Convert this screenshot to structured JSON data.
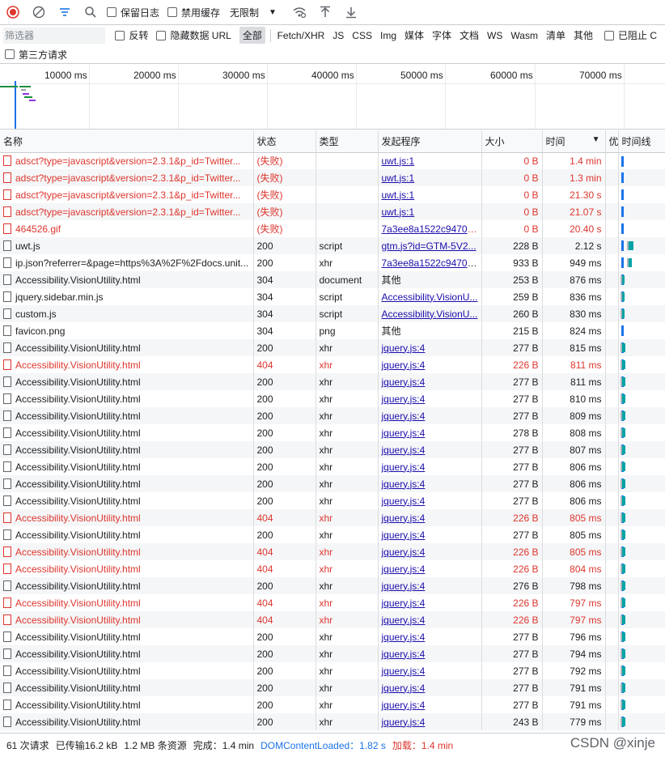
{
  "toolbar": {
    "preserve_log_label": "保留日志",
    "disable_cache_label": "禁用缓存",
    "throttle_value": "无限制"
  },
  "filter": {
    "placeholder": "筛选器",
    "invert_label": "反转",
    "hide_data_url_label": "隐藏数据 URL",
    "types": [
      "全部",
      "Fetch/XHR",
      "JS",
      "CSS",
      "Img",
      "媒体",
      "字体",
      "文档",
      "WS",
      "Wasm",
      "清单",
      "其他"
    ],
    "active_type": "全部",
    "blocked_label": "已阻止 C",
    "third_party_label": "第三方请求"
  },
  "overview": {
    "ticks": [
      "10000 ms",
      "20000 ms",
      "30000 ms",
      "40000 ms",
      "50000 ms",
      "60000 ms",
      "70000 ms"
    ]
  },
  "columns": {
    "name": "名称",
    "status": "状态",
    "type": "类型",
    "initiator": "发起程序",
    "size": "大小",
    "time": "时间",
    "extra": "优",
    "waterfall": "时间线"
  },
  "rows": [
    {
      "name": "adsct?type=javascript&version=2.3.1&p_id=Twitter...",
      "status": "(失败)",
      "type": "",
      "initiator": "uwt.js:1",
      "initiator_link": true,
      "size": "0 B",
      "time": "1.4 min",
      "fail": true
    },
    {
      "name": "adsct?type=javascript&version=2.3.1&p_id=Twitter...",
      "status": "(失败)",
      "type": "",
      "initiator": "uwt.js:1",
      "initiator_link": true,
      "size": "0 B",
      "time": "1.3 min",
      "fail": true
    },
    {
      "name": "adsct?type=javascript&version=2.3.1&p_id=Twitter...",
      "status": "(失败)",
      "type": "",
      "initiator": "uwt.js:1",
      "initiator_link": true,
      "size": "0 B",
      "time": "21.30 s",
      "fail": true
    },
    {
      "name": "adsct?type=javascript&version=2.3.1&p_id=Twitter...",
      "status": "(失败)",
      "type": "",
      "initiator": "uwt.js:1",
      "initiator_link": true,
      "size": "0 B",
      "time": "21.07 s",
      "fail": true
    },
    {
      "name": "464526.gif",
      "status": "(失败)",
      "type": "",
      "initiator": "7a3ee8a1522c9470.j...",
      "initiator_link": true,
      "size": "0 B",
      "time": "20.40 s",
      "fail": true
    },
    {
      "name": "uwt.js",
      "status": "200",
      "type": "script",
      "initiator": "gtm.js?id=GTM-5V2...",
      "initiator_link": true,
      "size": "228 B",
      "time": "2.12 s",
      "fail": false
    },
    {
      "name": "ip.json?referrer=&page=https%3A%2F%2Fdocs.unit...",
      "status": "200",
      "type": "xhr",
      "initiator": "7a3ee8a1522c9470.j...",
      "initiator_link": true,
      "size": "933 B",
      "time": "949 ms",
      "fail": false
    },
    {
      "name": "Accessibility.VisionUtility.html",
      "status": "304",
      "type": "document",
      "initiator": "其他",
      "initiator_link": false,
      "size": "253 B",
      "time": "876 ms",
      "fail": false
    },
    {
      "name": "jquery.sidebar.min.js",
      "status": "304",
      "type": "script",
      "initiator": "Accessibility.VisionU...",
      "initiator_link": true,
      "size": "259 B",
      "time": "836 ms",
      "fail": false
    },
    {
      "name": "custom.js",
      "status": "304",
      "type": "script",
      "initiator": "Accessibility.VisionU...",
      "initiator_link": true,
      "size": "260 B",
      "time": "830 ms",
      "fail": false
    },
    {
      "name": "favicon.png",
      "status": "304",
      "type": "png",
      "initiator": "其他",
      "initiator_link": false,
      "size": "215 B",
      "time": "824 ms",
      "fail": false
    },
    {
      "name": "Accessibility.VisionUtility.html",
      "status": "200",
      "type": "xhr",
      "initiator": "jquery.js:4",
      "initiator_link": true,
      "size": "277 B",
      "time": "815 ms",
      "fail": false
    },
    {
      "name": "Accessibility.VisionUtility.html",
      "status": "404",
      "type": "xhr",
      "initiator": "jquery.js:4",
      "initiator_link": true,
      "size": "226 B",
      "time": "811 ms",
      "fail": true
    },
    {
      "name": "Accessibility.VisionUtility.html",
      "status": "200",
      "type": "xhr",
      "initiator": "jquery.js:4",
      "initiator_link": true,
      "size": "277 B",
      "time": "811 ms",
      "fail": false
    },
    {
      "name": "Accessibility.VisionUtility.html",
      "status": "200",
      "type": "xhr",
      "initiator": "jquery.js:4",
      "initiator_link": true,
      "size": "277 B",
      "time": "810 ms",
      "fail": false
    },
    {
      "name": "Accessibility.VisionUtility.html",
      "status": "200",
      "type": "xhr",
      "initiator": "jquery.js:4",
      "initiator_link": true,
      "size": "277 B",
      "time": "809 ms",
      "fail": false
    },
    {
      "name": "Accessibility.VisionUtility.html",
      "status": "200",
      "type": "xhr",
      "initiator": "jquery.js:4",
      "initiator_link": true,
      "size": "278 B",
      "time": "808 ms",
      "fail": false
    },
    {
      "name": "Accessibility.VisionUtility.html",
      "status": "200",
      "type": "xhr",
      "initiator": "jquery.js:4",
      "initiator_link": true,
      "size": "277 B",
      "time": "807 ms",
      "fail": false
    },
    {
      "name": "Accessibility.VisionUtility.html",
      "status": "200",
      "type": "xhr",
      "initiator": "jquery.js:4",
      "initiator_link": true,
      "size": "277 B",
      "time": "806 ms",
      "fail": false
    },
    {
      "name": "Accessibility.VisionUtility.html",
      "status": "200",
      "type": "xhr",
      "initiator": "jquery.js:4",
      "initiator_link": true,
      "size": "277 B",
      "time": "806 ms",
      "fail": false
    },
    {
      "name": "Accessibility.VisionUtility.html",
      "status": "200",
      "type": "xhr",
      "initiator": "jquery.js:4",
      "initiator_link": true,
      "size": "277 B",
      "time": "806 ms",
      "fail": false
    },
    {
      "name": "Accessibility.VisionUtility.html",
      "status": "404",
      "type": "xhr",
      "initiator": "jquery.js:4",
      "initiator_link": true,
      "size": "226 B",
      "time": "805 ms",
      "fail": true
    },
    {
      "name": "Accessibility.VisionUtility.html",
      "status": "200",
      "type": "xhr",
      "initiator": "jquery.js:4",
      "initiator_link": true,
      "size": "277 B",
      "time": "805 ms",
      "fail": false
    },
    {
      "name": "Accessibility.VisionUtility.html",
      "status": "404",
      "type": "xhr",
      "initiator": "jquery.js:4",
      "initiator_link": true,
      "size": "226 B",
      "time": "805 ms",
      "fail": true
    },
    {
      "name": "Accessibility.VisionUtility.html",
      "status": "404",
      "type": "xhr",
      "initiator": "jquery.js:4",
      "initiator_link": true,
      "size": "226 B",
      "time": "804 ms",
      "fail": true
    },
    {
      "name": "Accessibility.VisionUtility.html",
      "status": "200",
      "type": "xhr",
      "initiator": "jquery.js:4",
      "initiator_link": true,
      "size": "276 B",
      "time": "798 ms",
      "fail": false
    },
    {
      "name": "Accessibility.VisionUtility.html",
      "status": "404",
      "type": "xhr",
      "initiator": "jquery.js:4",
      "initiator_link": true,
      "size": "226 B",
      "time": "797 ms",
      "fail": true
    },
    {
      "name": "Accessibility.VisionUtility.html",
      "status": "404",
      "type": "xhr",
      "initiator": "jquery.js:4",
      "initiator_link": true,
      "size": "226 B",
      "time": "797 ms",
      "fail": true
    },
    {
      "name": "Accessibility.VisionUtility.html",
      "status": "200",
      "type": "xhr",
      "initiator": "jquery.js:4",
      "initiator_link": true,
      "size": "277 B",
      "time": "796 ms",
      "fail": false
    },
    {
      "name": "Accessibility.VisionUtility.html",
      "status": "200",
      "type": "xhr",
      "initiator": "jquery.js:4",
      "initiator_link": true,
      "size": "277 B",
      "time": "794 ms",
      "fail": false
    },
    {
      "name": "Accessibility.VisionUtility.html",
      "status": "200",
      "type": "xhr",
      "initiator": "jquery.js:4",
      "initiator_link": true,
      "size": "277 B",
      "time": "792 ms",
      "fail": false
    },
    {
      "name": "Accessibility.VisionUtility.html",
      "status": "200",
      "type": "xhr",
      "initiator": "jquery.js:4",
      "initiator_link": true,
      "size": "277 B",
      "time": "791 ms",
      "fail": false
    },
    {
      "name": "Accessibility.VisionUtility.html",
      "status": "200",
      "type": "xhr",
      "initiator": "jquery.js:4",
      "initiator_link": true,
      "size": "277 B",
      "time": "791 ms",
      "fail": false
    },
    {
      "name": "Accessibility.VisionUtility.html",
      "status": "200",
      "type": "xhr",
      "initiator": "jquery.js:4",
      "initiator_link": true,
      "size": "243 B",
      "time": "779 ms",
      "fail": false
    }
  ],
  "status_bar": {
    "requests": "61 次请求",
    "transferred": "已传输16.2 kB",
    "resources": "1.2 MB 条资源",
    "finish": "完成：1.4 min",
    "dcl": "DOMContentLoaded：1.82 s",
    "load": "加载：1.4 min"
  },
  "watermark": "CSDN @xinje",
  "colors": {
    "error": "#dc362e",
    "link": "#1a0dab",
    "waterfall": "#00a3a6",
    "dcl": "#1a73e8"
  }
}
